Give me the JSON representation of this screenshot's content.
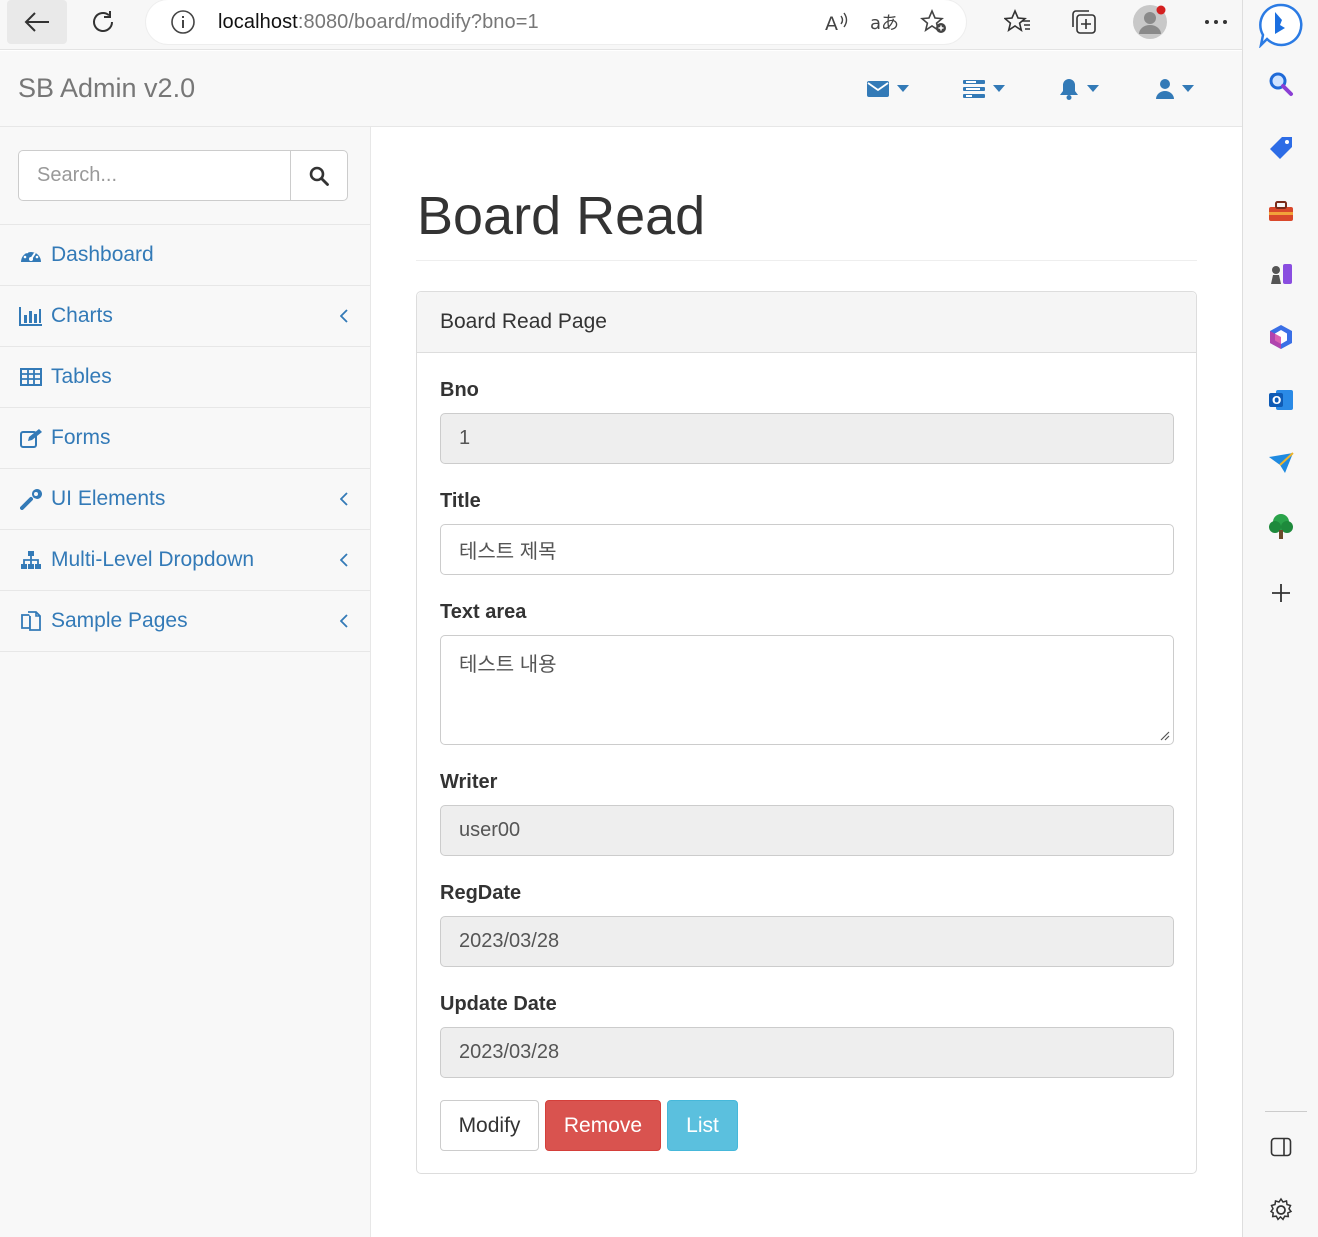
{
  "browser": {
    "url_host": "localhost",
    "url_rest": ":8080/board/modify?bno=1"
  },
  "app": {
    "brand": "SB Admin v2.0",
    "search_placeholder": "Search..."
  },
  "sidebar": {
    "items": [
      {
        "label": "Dashboard",
        "icon": "dashboard-icon",
        "has_arrow": false
      },
      {
        "label": "Charts",
        "icon": "bar-chart-icon",
        "has_arrow": true
      },
      {
        "label": "Tables",
        "icon": "table-icon",
        "has_arrow": false
      },
      {
        "label": "Forms",
        "icon": "edit-icon",
        "has_arrow": false
      },
      {
        "label": "UI Elements",
        "icon": "wrench-icon",
        "has_arrow": true
      },
      {
        "label": "Multi-Level Dropdown",
        "icon": "sitemap-icon",
        "has_arrow": true
      },
      {
        "label": "Sample Pages",
        "icon": "files-icon",
        "has_arrow": true
      }
    ]
  },
  "main": {
    "page_title": "Board Read",
    "panel_heading": "Board Read Page",
    "fields": {
      "bno": {
        "label": "Bno",
        "value": "1"
      },
      "title": {
        "label": "Title",
        "value": "테스트 제목"
      },
      "content": {
        "label": "Text area",
        "value": "테스트 내용"
      },
      "writer": {
        "label": "Writer",
        "value": "user00"
      },
      "regdate": {
        "label": "RegDate",
        "value": "2023/03/28"
      },
      "updatedate": {
        "label": "Update Date",
        "value": "2023/03/28"
      }
    },
    "buttons": {
      "modify": "Modify",
      "remove": "Remove",
      "list": "List"
    }
  },
  "colors": {
    "link": "#337ab7",
    "danger": "#d9534f",
    "info": "#5bc0de"
  }
}
